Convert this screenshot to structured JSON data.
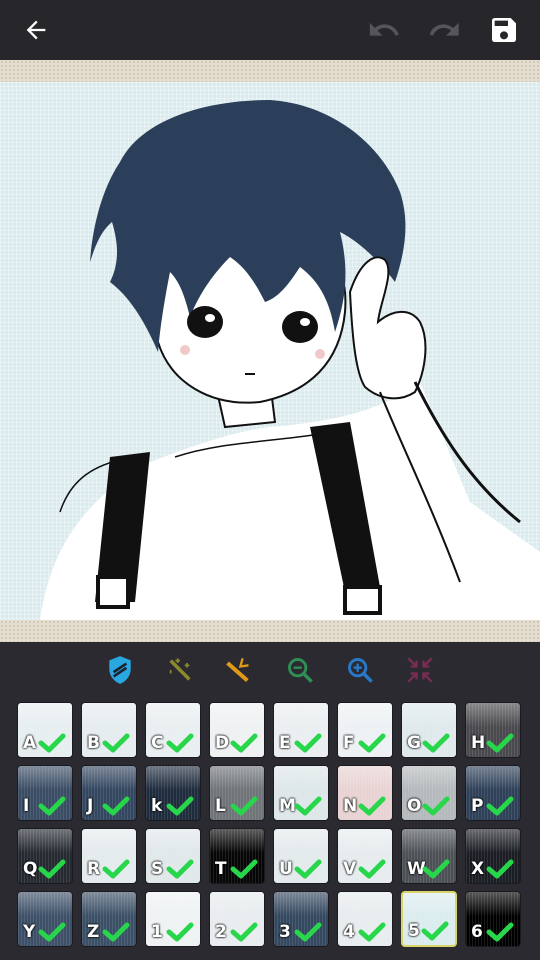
{
  "toolbar": {
    "back": "back-arrow-icon",
    "undo": "undo-icon",
    "redo": "redo-icon",
    "save": "save-icon"
  },
  "tools": [
    {
      "name": "shield-tool",
      "color": "#29a7e0"
    },
    {
      "name": "magic-wand-tool",
      "color": "#8a8a2a"
    },
    {
      "name": "fill-wand-tool",
      "color": "#e09a17"
    },
    {
      "name": "zoom-out-tool",
      "color": "#2f8f55"
    },
    {
      "name": "zoom-in-tool",
      "color": "#2a78c8"
    },
    {
      "name": "collapse-tool",
      "color": "#7a2c55"
    }
  ],
  "palette": [
    {
      "label": "A",
      "color": "#e7eef0",
      "done": true
    },
    {
      "label": "B",
      "color": "#e5ecef",
      "done": true
    },
    {
      "label": "C",
      "color": "#e9eef0",
      "done": true
    },
    {
      "label": "D",
      "color": "#eef1f2",
      "done": true
    },
    {
      "label": "E",
      "color": "#eaeef0",
      "done": true
    },
    {
      "label": "F",
      "color": "#edf1f3",
      "done": true
    },
    {
      "label": "G",
      "color": "#dfe9ec",
      "done": true
    },
    {
      "label": "H",
      "color": "#4a4a4e",
      "done": true
    },
    {
      "label": "I",
      "color": "#3a4d64",
      "done": true
    },
    {
      "label": "J",
      "color": "#344760",
      "done": true
    },
    {
      "label": "k",
      "color": "#1f2c3e",
      "done": true
    },
    {
      "label": "L",
      "color": "#6f7478",
      "done": true
    },
    {
      "label": "M",
      "color": "#dde6e8",
      "done": true
    },
    {
      "label": "N",
      "color": "#e8d2d2",
      "done": true
    },
    {
      "label": "O",
      "color": "#b4b9bb",
      "done": true
    },
    {
      "label": "P",
      "color": "#2e4158",
      "done": true
    },
    {
      "label": "Q",
      "color": "#252a31",
      "done": true
    },
    {
      "label": "R",
      "color": "#e4ebed",
      "done": true
    },
    {
      "label": "S",
      "color": "#e0e8ea",
      "done": true
    },
    {
      "label": "T",
      "color": "#060607",
      "done": true
    },
    {
      "label": "U",
      "color": "#e3eaec",
      "done": true
    },
    {
      "label": "V",
      "color": "#e6ecee",
      "done": true
    },
    {
      "label": "W",
      "color": "#4c5156",
      "done": true
    },
    {
      "label": "X",
      "color": "#1a1d23",
      "done": true
    },
    {
      "label": "Y",
      "color": "#3d5068",
      "done": true
    },
    {
      "label": "Z",
      "color": "#3b5066",
      "done": true
    },
    {
      "label": "1",
      "color": "#eef2f3",
      "done": true
    },
    {
      "label": "2",
      "color": "#e8ecee",
      "done": true
    },
    {
      "label": "3",
      "color": "#34485f",
      "done": true
    },
    {
      "label": "4",
      "color": "#e7ecee",
      "done": true
    },
    {
      "label": "5",
      "color": "#dbecee",
      "done": true,
      "selected": true
    },
    {
      "label": "6",
      "color": "#000000",
      "done": true
    }
  ]
}
